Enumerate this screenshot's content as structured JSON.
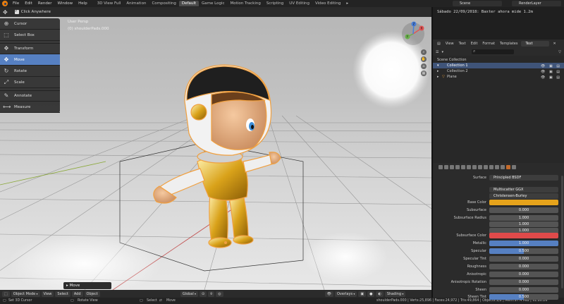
{
  "topbar": {
    "menus": [
      "File",
      "Edit",
      "Render",
      "Window",
      "Help"
    ],
    "workspaces": [
      "3D View Full",
      "Animation",
      "Compositing",
      "Default",
      "Game Logic",
      "Motion Tracking",
      "Scripting",
      "UV Editing",
      "Video Editing"
    ],
    "active_workspace": "Default",
    "scene": "Scene",
    "render_layer": "RenderLayer"
  },
  "viewport_header": {
    "tool_option": "Click Anywhere"
  },
  "viewport": {
    "view_name": "User Persp",
    "object_info": "(0) shoulderPads.000"
  },
  "toolbar": {
    "tools": [
      {
        "label": "Cursor",
        "icon": "⊕"
      },
      {
        "label": "Select Box",
        "icon": "⬚"
      },
      {
        "label": "Transform",
        "icon": "✥"
      },
      {
        "label": "Move",
        "icon": "✥"
      },
      {
        "label": "Rotate",
        "icon": "↻"
      },
      {
        "label": "Scale",
        "icon": "⤢"
      },
      {
        "label": "Annotate",
        "icon": "✎"
      },
      {
        "label": "Measure",
        "icon": "📏"
      }
    ],
    "active_tool": "Move"
  },
  "gizmo": {
    "x": "X",
    "y": "Y",
    "z": "Z"
  },
  "redo_panel": {
    "label": "Move"
  },
  "viewport_bottom": {
    "mode": "Object Mode",
    "menus": [
      "View",
      "Select",
      "Add",
      "Object"
    ],
    "orientation": "Global",
    "overlays": "Overlays",
    "shading": "Shading"
  },
  "statusbar": {
    "set_cursor": "Set 3D Cursor",
    "rotate_view": "Rotate View",
    "select": "Select",
    "move": "Move",
    "stats": "shoulderPads.000 | Verts:25,896 | Faces:24,972 | Tris:49,864 | Objects:1/8 | Mem:97.4 MiB | v2.80.26"
  },
  "text_editor": {
    "content": "Sábado 22/09/2018: Baxter ahora mide 1.2m",
    "menus": [
      "View",
      "Text",
      "Edit",
      "Format",
      "Templates"
    ],
    "text_name": "Text"
  },
  "outliner": {
    "rows": [
      {
        "label": "Scene Collection",
        "indent": 6,
        "selected": false,
        "vis": ""
      },
      {
        "label": "Collection 1",
        "indent": 20,
        "selected": true,
        "vis": "👁 ▣ ▤"
      },
      {
        "label": "Collection 2",
        "indent": 20,
        "selected": false,
        "vis": "👁 ▣ ▤"
      },
      {
        "label": "Plane",
        "indent": 20,
        "selected": false,
        "vis": "👁 ▣ ▤"
      }
    ]
  },
  "properties": {
    "surface_label": "Surface",
    "surface_value": "Principled BSDF",
    "distribution": "Multiscatter GGX",
    "subsurface_method": "Christensen-Burley",
    "rows": [
      {
        "label": "Base Color",
        "value": "",
        "kind": "color",
        "color": "#e6a31b"
      },
      {
        "label": "Subsurface",
        "value": "0.000",
        "kind": "plain"
      },
      {
        "label": "Subsurface Radius",
        "value": "1.000",
        "kind": "plain"
      },
      {
        "label": "",
        "value": "1.000",
        "kind": "plain"
      },
      {
        "label": "",
        "value": "1.000",
        "kind": "plain"
      },
      {
        "label": "Subsurface Color",
        "value": "",
        "kind": "color",
        "color": "#e04a4a"
      },
      {
        "label": "Metallic",
        "value": "1.000",
        "kind": "blue"
      },
      {
        "label": "Specular",
        "value": "0.500",
        "kind": "half"
      },
      {
        "label": "Specular Tint",
        "value": "0.000",
        "kind": "plain"
      },
      {
        "label": "Roughness",
        "value": "0.000",
        "kind": "plain"
      },
      {
        "label": "Anisotropic",
        "value": "0.000",
        "kind": "plain"
      },
      {
        "label": "Anisotropic Rotation",
        "value": "0.000",
        "kind": "plain"
      },
      {
        "label": "Sheen",
        "value": "0.000",
        "kind": "plain"
      },
      {
        "label": "Sheen Tint",
        "value": "0.500",
        "kind": "half"
      }
    ]
  }
}
